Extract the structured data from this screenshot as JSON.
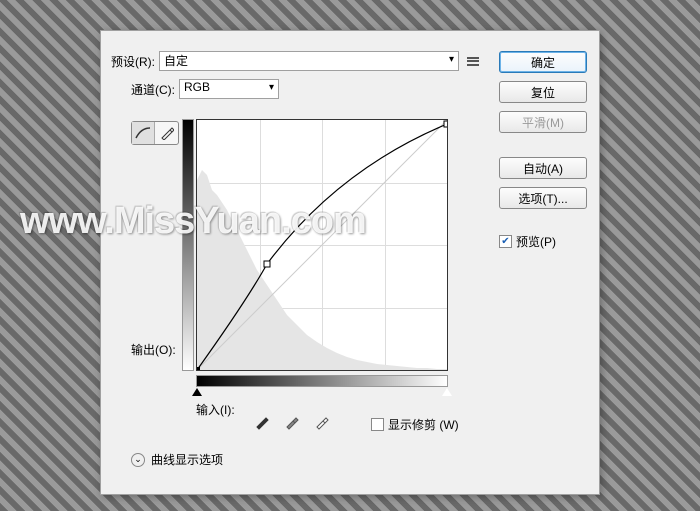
{
  "preset": {
    "label": "预设(R):",
    "value": "自定"
  },
  "channel": {
    "label": "通道(C):",
    "value": "RGB"
  },
  "output": {
    "label": "输出(O):"
  },
  "input": {
    "label": "输入(I):"
  },
  "clip": {
    "label": "显示修剪 (W)"
  },
  "disclosure": {
    "label": "曲线显示选项"
  },
  "buttons": {
    "ok": "确定",
    "reset": "复位",
    "smooth": "平滑(M)",
    "auto": "自动(A)",
    "options": "选项(T)..."
  },
  "preview": {
    "label": "预览(P)"
  },
  "watermark": "www.MissYuan.com",
  "chart_data": {
    "type": "line",
    "title": "",
    "xlabel": "输入",
    "ylabel": "输出",
    "xlim": [
      0,
      255
    ],
    "ylim": [
      0,
      255
    ],
    "curve_points": [
      {
        "x": 0,
        "y": 0
      },
      {
        "x": 71,
        "y": 108
      },
      {
        "x": 255,
        "y": 255
      }
    ]
  }
}
